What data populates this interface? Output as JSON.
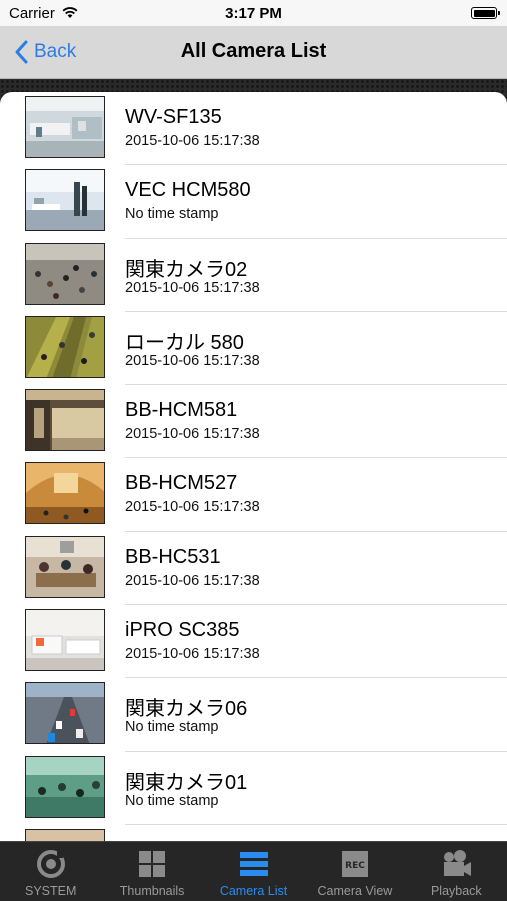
{
  "status_bar": {
    "carrier": "Carrier",
    "time": "3:17 PM"
  },
  "nav": {
    "back_label": "Back",
    "title": "All Camera List"
  },
  "cameras": [
    {
      "name": "WV-SF135",
      "timestamp": "2015-10-06 15:17:38",
      "thumb": "lab"
    },
    {
      "name": "VEC HCM580",
      "timestamp": "No time stamp",
      "thumb": "office"
    },
    {
      "name": "関東カメラ02",
      "timestamp": "2015-10-06 15:17:38",
      "thumb": "crowd"
    },
    {
      "name": "ローカル 580",
      "timestamp": "2015-10-06 15:17:38",
      "thumb": "escalator"
    },
    {
      "name": "BB-HCM581",
      "timestamp": "2015-10-06 15:17:38",
      "thumb": "subway"
    },
    {
      "name": "BB-HCM527",
      "timestamp": "2015-10-06 15:17:38",
      "thumb": "station"
    },
    {
      "name": "BB-HC531",
      "timestamp": "2015-10-06 15:17:38",
      "thumb": "meeting"
    },
    {
      "name": "iPRO SC385",
      "timestamp": "2015-10-06 15:17:38",
      "thumb": "living"
    },
    {
      "name": "関東カメラ06",
      "timestamp": "No time stamp",
      "thumb": "traffic"
    },
    {
      "name": "関東カメラ01",
      "timestamp": "No time stamp",
      "thumb": "street"
    }
  ],
  "tabs": [
    {
      "label": "SYSTEM",
      "icon": "system-icon",
      "active": false
    },
    {
      "label": "Thumbnails",
      "icon": "thumbnails-icon",
      "active": false
    },
    {
      "label": "Camera List",
      "icon": "camera-list-icon",
      "active": true
    },
    {
      "label": "Camera View",
      "icon": "camera-view-icon",
      "active": false
    },
    {
      "label": "Playback",
      "icon": "playback-icon",
      "active": false
    }
  ],
  "colors": {
    "accent": "#2b8cf0",
    "nav_bg": "#d8d8d8",
    "tabbar_bg": "#262626"
  }
}
